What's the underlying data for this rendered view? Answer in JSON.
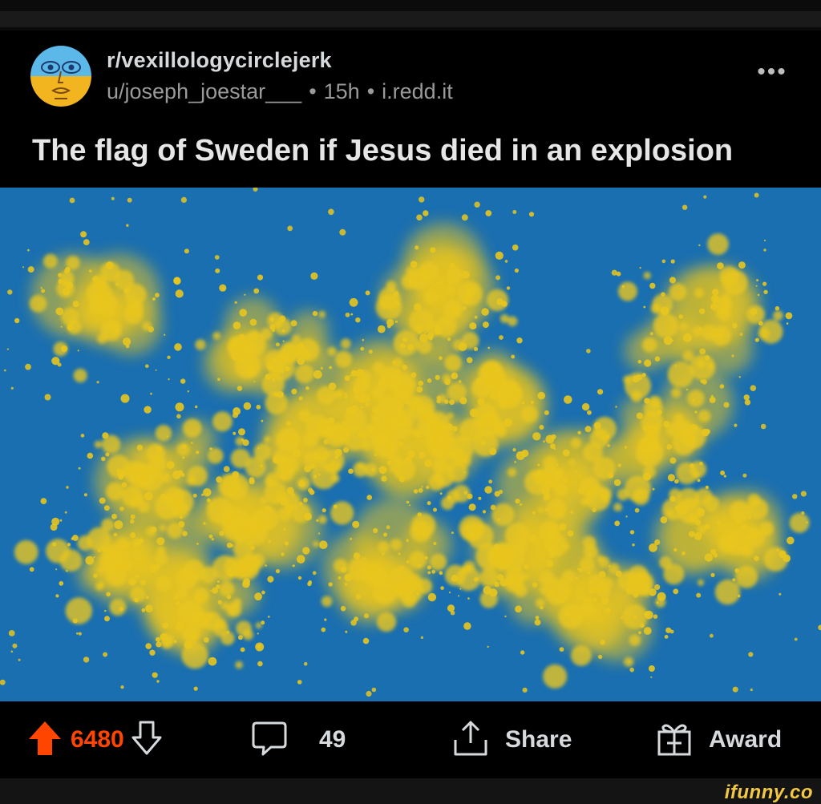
{
  "post": {
    "subreddit": "r/vexillologycirclejerk",
    "author": "u/joseph_joestar___",
    "time": "15h",
    "domain": "i.redd.it",
    "separator": "•",
    "more_label": "•••",
    "title": "The flag of Sweden if Jesus died in an explosion"
  },
  "actions": {
    "upvotes": "6480",
    "comments": "49",
    "share_label": "Share",
    "award_label": "Award"
  },
  "colors": {
    "upvote": "#ff4500",
    "flag_blue": "#1a6fb0",
    "flag_yellow": "#e8c51e"
  },
  "icons": {
    "upvote": "arrow-up-icon",
    "downvote": "arrow-down-icon",
    "comment": "comment-bubble-icon",
    "share": "share-icon",
    "award": "gift-icon",
    "more": "more-dots-icon"
  },
  "watermark": "ifunny.co"
}
